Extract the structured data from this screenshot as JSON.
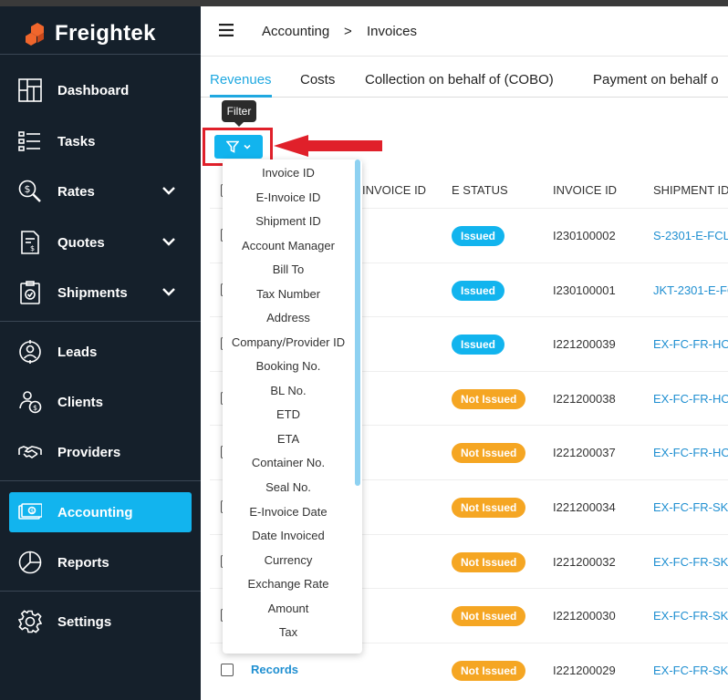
{
  "brand": {
    "name": "Freightek",
    "logo_color": "#f0662c"
  },
  "sidebar": {
    "items": [
      {
        "label": "Dashboard",
        "icon": "dashboard-icon"
      },
      {
        "label": "Tasks",
        "icon": "tasks-icon"
      },
      {
        "label": "Rates",
        "icon": "rates-icon",
        "expandable": true
      },
      {
        "label": "Quotes",
        "icon": "quotes-icon",
        "expandable": true
      },
      {
        "label": "Shipments",
        "icon": "shipments-icon",
        "expandable": true
      },
      {
        "label": "Leads",
        "icon": "leads-icon"
      },
      {
        "label": "Clients",
        "icon": "clients-icon"
      },
      {
        "label": "Providers",
        "icon": "providers-icon"
      },
      {
        "label": "Accounting",
        "icon": "accounting-icon",
        "active": true
      },
      {
        "label": "Reports",
        "icon": "reports-icon"
      },
      {
        "label": "Settings",
        "icon": "settings-icon"
      }
    ],
    "active_color": "#12b4ee",
    "bg_color": "#15202b"
  },
  "breadcrumb": {
    "section": "Accounting",
    "separator": ">",
    "page": "Invoices"
  },
  "tabs": [
    {
      "label": "Revenues",
      "active": true
    },
    {
      "label": "Costs"
    },
    {
      "label": "Collection on behalf of (COBO)"
    },
    {
      "label": "Payment on behalf o"
    }
  ],
  "filter": {
    "tooltip": "Filter",
    "icon": "filter-icon"
  },
  "table": {
    "columns": {
      "invoice_id_partial": "INVOICE ID",
      "e_status": "E STATUS",
      "invoice_id": "INVOICE ID",
      "shipment_id": "SHIPMENT ID"
    },
    "rows": [
      {
        "status": "Issued",
        "invoice": "I230100002",
        "shipment": "S-2301-E-FCL"
      },
      {
        "status": "Issued",
        "invoice": "I230100001",
        "shipment": "JKT-2301-E-FC"
      },
      {
        "status": "Issued",
        "invoice": "I221200039",
        "shipment": "EX-FC-FR-HO"
      },
      {
        "status": "Not Issued",
        "invoice": "I221200038",
        "shipment": "EX-FC-FR-HO"
      },
      {
        "status": "Not Issued",
        "invoice": "I221200037",
        "shipment": "EX-FC-FR-HO"
      },
      {
        "status": "Not Issued",
        "invoice": "I221200034",
        "shipment": "EX-FC-FR-SKI"
      },
      {
        "status": "Not Issued",
        "invoice": "I221200032",
        "shipment": "EX-FC-FR-SKI"
      },
      {
        "status": "Not Issued",
        "invoice": "I221200030",
        "shipment": "EX-FC-FR-SKI"
      },
      {
        "status": "Not Issued",
        "invoice": "I221200029",
        "shipment": "EX-FC-FR-SKI",
        "record_link": "Records"
      }
    ],
    "status_colors": {
      "Issued": "#12b4ee",
      "Not Issued": "#f5a623"
    }
  },
  "filter_menu": {
    "options": [
      "Invoice ID",
      "E-Invoice ID",
      "Shipment ID",
      "Account Manager",
      "Bill To",
      "Tax Number",
      "Address",
      "Company/Provider ID",
      "Booking No.",
      "BL No.",
      "ETD",
      "ETA",
      "Container No.",
      "Seal No.",
      "E-Invoice Date",
      "Date Invoiced",
      "Currency",
      "Exchange Rate",
      "Amount",
      "Tax"
    ]
  },
  "annotation": {
    "color": "#e0202a"
  }
}
